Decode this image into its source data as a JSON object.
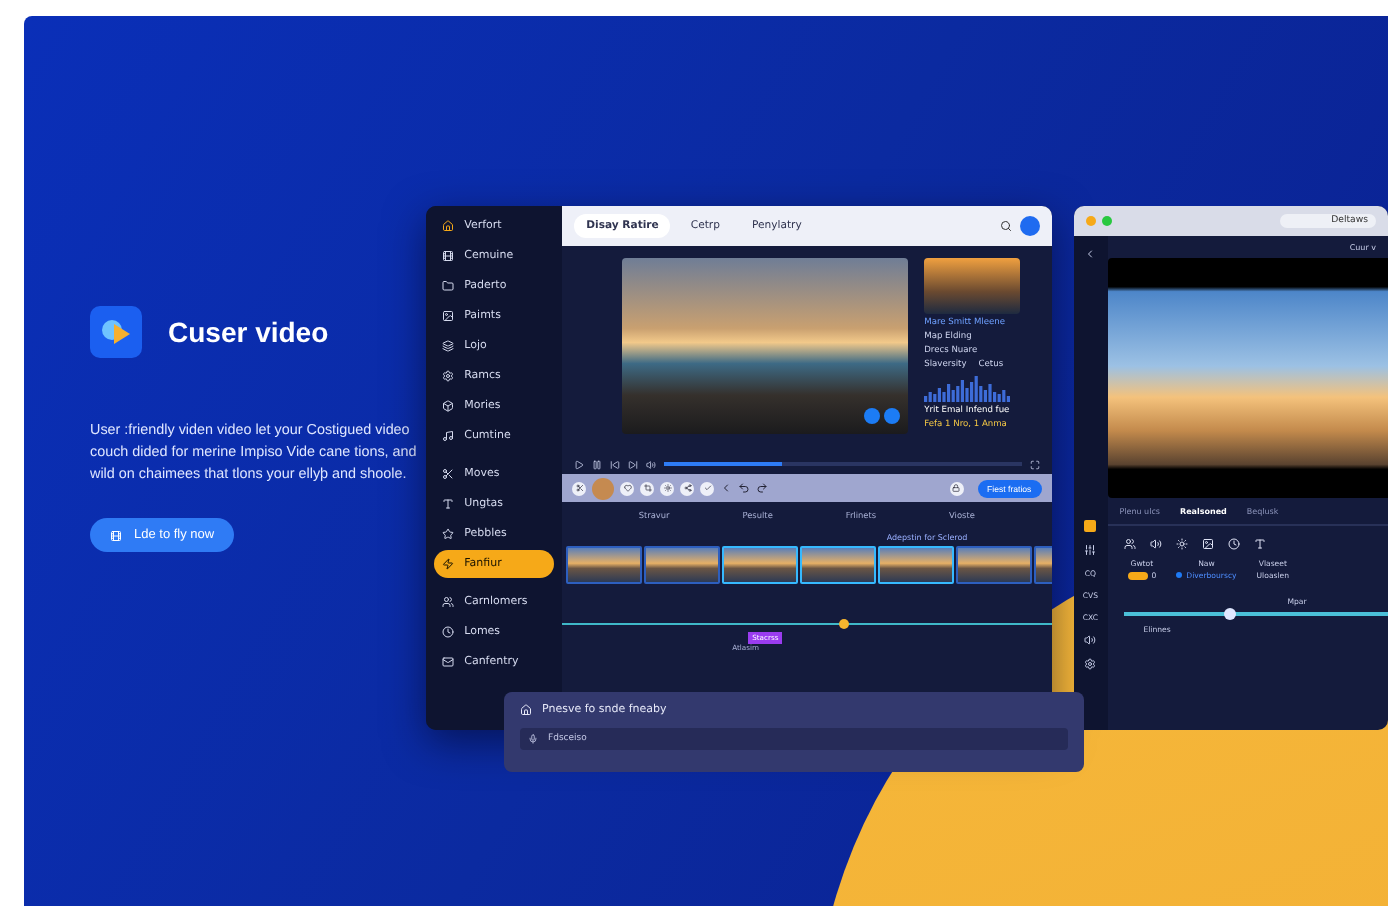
{
  "hero": {
    "title": "Cuser video",
    "description": "User :friendly viden video let your Costigued video couch dided for merine Impiso Vide cane tions, and wild on chaimees that tlons your ellyþ and shoole.",
    "cta": "Lde to fly now"
  },
  "editor": {
    "sidebar": [
      {
        "label": "Verfort",
        "selected": false,
        "brand": true
      },
      {
        "label": "Cemuine",
        "selected": false
      },
      {
        "label": "Paderto",
        "selected": false
      },
      {
        "label": "Paimts",
        "selected": false
      },
      {
        "label": "Lojo",
        "selected": false
      },
      {
        "label": "Ramcs",
        "selected": false
      },
      {
        "label": "Mories",
        "selected": false
      },
      {
        "label": "Cumtine",
        "selected": false
      },
      {
        "label": "Moves",
        "selected": false
      },
      {
        "label": "Ungtas",
        "selected": false
      },
      {
        "label": "Pebbles",
        "selected": false
      },
      {
        "label": "Fanfiur",
        "selected": true
      },
      {
        "label": "Carnlomers",
        "selected": false
      },
      {
        "label": "Lomes",
        "selected": false
      },
      {
        "label": "Canfentry",
        "selected": false
      }
    ],
    "tabs": [
      {
        "label": "Disay Ratire",
        "selected": true
      },
      {
        "label": "Cetrp",
        "selected": false
      },
      {
        "label": "Penylatry",
        "selected": false
      }
    ],
    "info": {
      "caption": "Mare Smitt Mleene",
      "title": "Map Elding",
      "subtitle": "Drecs Nuare",
      "meta_1": "Slaversity",
      "meta_2": "Cetus",
      "footer_1": "Yrit Emal Infend fue",
      "footer_2": "Fefa 1 Nro, 1 Anma"
    },
    "playback": {
      "level": 0.33
    },
    "toolbar": {
      "button": "Fiest fratios"
    },
    "ruler": [
      "Stravur",
      "Pesulte",
      "Frlinets",
      "Vioste"
    ],
    "note": "Adepstin for Sclerod",
    "clip_label": "Stacrss",
    "clip_tag": "Atlasim",
    "panel": {
      "title": "Pnesve fo snde fneaby",
      "item": "Fdsceiso"
    }
  },
  "viewer": {
    "address": "Deltaws",
    "zoom": "Cuur v",
    "tabs": [
      {
        "label": "Plenu ulcs",
        "selected": false
      },
      {
        "label": "Realsoned",
        "selected": true
      },
      {
        "label": "Beqlusk",
        "selected": false
      }
    ],
    "side_labels": [
      "CQ",
      "CVS",
      "CXC"
    ],
    "controls": [
      {
        "label": "Gwtot",
        "kind": "toggle",
        "on": true,
        "value": "0"
      },
      {
        "label": "Naw",
        "kind": "chip",
        "value": "Diverbourscy"
      },
      {
        "label": "Vlaseet",
        "kind": "text",
        "value": "Uloaslen"
      }
    ],
    "slider": {
      "level": 0.38,
      "start": "Elinnes",
      "mark": "Mpar"
    }
  }
}
